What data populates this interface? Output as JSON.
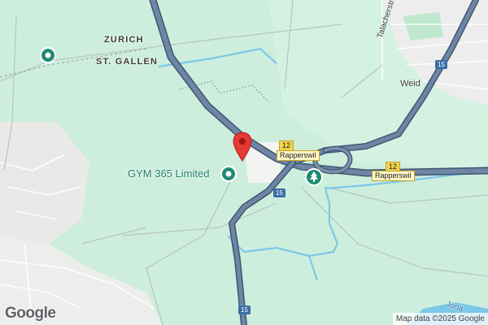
{
  "labels": {
    "zurich": "ZURICH",
    "st_gallen": "ST. GALLEN",
    "talacherstrasse": "Talacherstrasse",
    "weid": "Weid",
    "gym": "GYM 365 Limited",
    "jona": "Jona"
  },
  "shields": {
    "route15_top": "15",
    "route15_mid": "15",
    "route15_bottom": "15",
    "route12_a": "12",
    "route12_b": "12",
    "rapperswil_a": "Rapperswil",
    "rapperswil_b": "Rapperswil"
  },
  "footer": {
    "logo": "Google",
    "attribution": "Map data ©2025 Google"
  },
  "icons": {
    "location_pin": "red-location-pin",
    "gym_marker": "teal-poi-marker",
    "park_marker": "tree-marker",
    "left_marker": "teal-poi-marker"
  },
  "colors": {
    "background": "#cdeedd",
    "highway": "#6b82a0",
    "water": "#7cc8e8",
    "poi_teal": "#1e8a72",
    "pin_red": "#e53935"
  }
}
